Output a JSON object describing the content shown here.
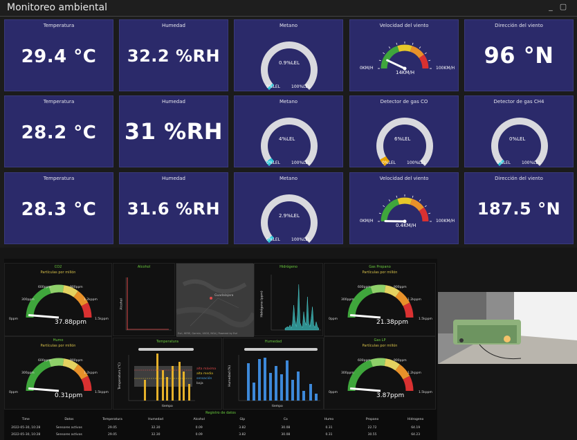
{
  "window": {
    "title": "Monitoreo ambiental"
  },
  "panels": [
    {
      "id": "r1c1",
      "title": "Temperatura",
      "kind": "stat",
      "value": "29.4 °C"
    },
    {
      "id": "r1c2",
      "title": "Humedad",
      "kind": "stat",
      "value": "32.2 %RH"
    },
    {
      "id": "r1c3",
      "title": "Metano",
      "kind": "gauge",
      "value": 0.9,
      "max": 100,
      "value_text": "0.9%LEL",
      "min_label": "0%LEL",
      "max_label": "100%LEL"
    },
    {
      "id": "r1c4",
      "title": "Velocidad del viento",
      "kind": "wind",
      "value": 14,
      "max": 100,
      "value_text": "14KM/H",
      "min_label": "0KM/H",
      "max_label": "100KM/H"
    },
    {
      "id": "r1c5",
      "title": "Dirección del viento",
      "kind": "stat",
      "value": "96 °N"
    },
    {
      "id": "r2c1",
      "title": "Temperatura",
      "kind": "stat",
      "value": "28.2 °C"
    },
    {
      "id": "r2c2",
      "title": "Humedad",
      "kind": "stat",
      "value": "31 %RH"
    },
    {
      "id": "r2c3",
      "title": "Metano",
      "kind": "gauge",
      "value": 4,
      "max": 100,
      "value_text": "4%LEL",
      "min_label": "0%LEL",
      "max_label": "100%LEL"
    },
    {
      "id": "r2c4",
      "title": "Detector de gas CO",
      "kind": "gauge",
      "value": 6,
      "max": 100,
      "value_text": "6%LEL",
      "min_label": "0%LEL",
      "max_label": "100%LEL",
      "fill": "#e8a300"
    },
    {
      "id": "r2c5",
      "title": "Detector de gas CH4",
      "kind": "gauge",
      "value": 0,
      "max": 100,
      "value_text": "0%LEL",
      "min_label": "0%LEL",
      "max_label": "100%LEL"
    },
    {
      "id": "r3c1",
      "title": "Temperatura",
      "kind": "stat",
      "value": "28.3 °C"
    },
    {
      "id": "r3c2",
      "title": "Humedad",
      "kind": "stat",
      "value": "31.6 %RH"
    },
    {
      "id": "r3c3",
      "title": "Metano",
      "kind": "gauge",
      "value": 2.9,
      "max": 100,
      "value_text": "2.9%LEL",
      "min_label": "0%LEL",
      "max_label": "100%LEL"
    },
    {
      "id": "r3c4",
      "title": "Velocidad del viento",
      "kind": "wind",
      "value": 0.4,
      "max": 100,
      "value_text": "0.4KM/H",
      "min_label": "0KM/H",
      "max_label": "100KM/H"
    },
    {
      "id": "r3c5",
      "title": "Dirección del viento",
      "kind": "stat",
      "value": "187.5 °N"
    }
  ],
  "colors": {
    "panel_bg": "#2b2a6a",
    "gauge_track": "#d9d9de",
    "gauge_fill": "#29c6d8",
    "green": "#3fa63c",
    "yellow": "#e6c72a",
    "orange": "#e8912a",
    "red": "#d93131"
  },
  "grafana": {
    "gauges": [
      {
        "id": "co2",
        "title": "CO2",
        "subtitle": "Partículas por millón",
        "value_text": "37.88ppm",
        "ticks": [
          "0ppm",
          "300ppm",
          "600ppm",
          "900ppm",
          "1.2kppm",
          "1.5kppm"
        ]
      },
      {
        "id": "hum",
        "title": "Humo",
        "subtitle": "Partículas por millón",
        "value_text": "0.31ppm",
        "ticks": [
          "0ppm",
          "300ppm",
          "600ppm",
          "900ppm",
          "1.2kppm",
          "1.5kppm"
        ]
      },
      {
        "id": "propano",
        "title": "Gas Propano",
        "subtitle": "Partículas por millón",
        "value_text": "21.38ppm",
        "ticks": [
          "0ppm",
          "300ppm",
          "600ppm",
          "900ppm",
          "1.2kppm",
          "1.5kppm"
        ]
      },
      {
        "id": "glp",
        "title": "Gas LP",
        "subtitle": "Partículas por millón",
        "value_text": "3.87ppm",
        "ticks": [
          "0ppm",
          "300ppm",
          "600ppm",
          "900ppm",
          "1.2kppm",
          "1.5kppm"
        ]
      }
    ],
    "panels": {
      "alcohol": "Alcohol",
      "hidrogeno": "Hidrógeno",
      "temperatura": "Temperatura",
      "humedad": "Humedad",
      "map_label": "Guadalajara",
      "map_attribution": "Esri, HERE, Garmin, USGS, NGA | Powered by Esri"
    },
    "alcohol_y": "Alcohol",
    "hidrogeno_y": "Hidrógeno (ppm)",
    "temp_y": "Temperatura (°C)",
    "hum_y": "Humedad (%)",
    "x_label": "tiempo",
    "temp_legend": [
      "alta máxima",
      "alta media",
      "sensación",
      "baja"
    ],
    "table": {
      "title": "Registro de datos",
      "columns": [
        "Time",
        "Datos",
        "Temperatura",
        "Humedad",
        "Alcohol",
        "Glp",
        "Co",
        "Humo",
        "Propano",
        "Hidrogeno"
      ],
      "rows": [
        [
          "2022-05-30, 10:28",
          "Sensores activos",
          "29.05",
          "32.30",
          "0.09",
          "3.82",
          "30.08",
          "0.31",
          "22.72",
          "64.19"
        ],
        [
          "2022-05-30, 10:28",
          "Sensores activos",
          "29.05",
          "32.30",
          "0.09",
          "3.82",
          "30.08",
          "0.31",
          "30.55",
          "64.23"
        ]
      ]
    }
  }
}
